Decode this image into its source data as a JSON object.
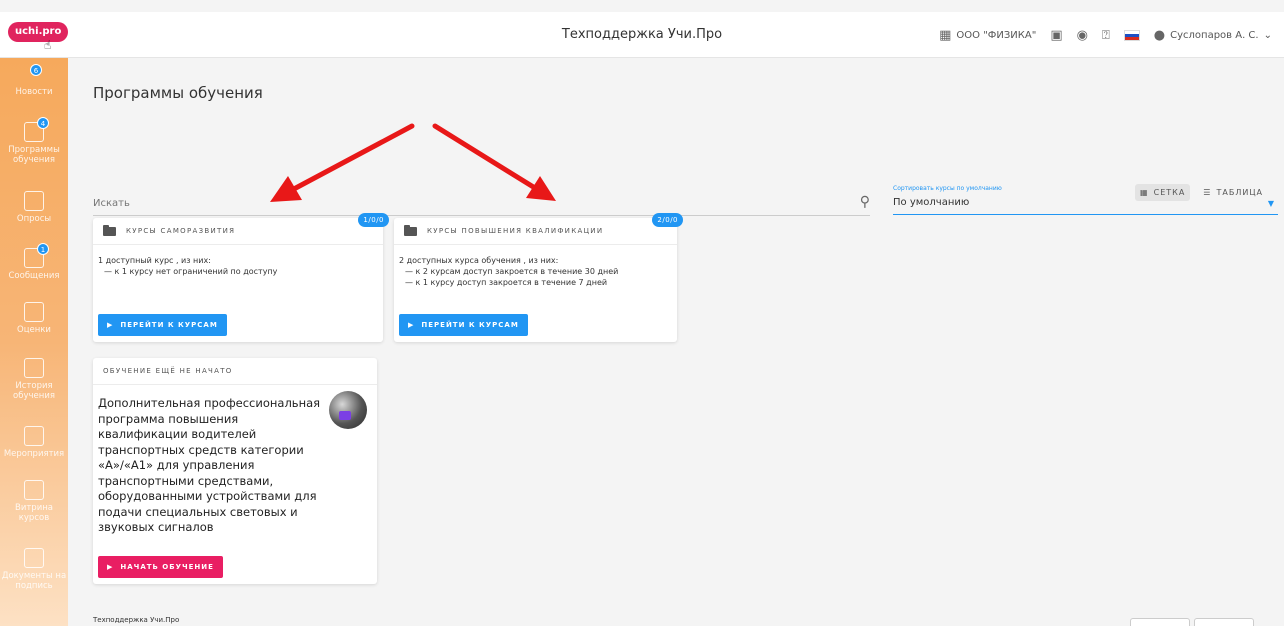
{
  "header": {
    "logo_text": "uchi.pro",
    "title": "Техподдержка Учи.Про",
    "org": "ООО \"ФИЗИКА\"",
    "user": "Суслопаров А. С."
  },
  "sidebar": {
    "items": [
      {
        "label": "Новости",
        "badge": "6"
      },
      {
        "label": "Программы обучения",
        "badge": "4"
      },
      {
        "label": "Опросы",
        "badge": ""
      },
      {
        "label": "Сообщения",
        "badge": "1"
      },
      {
        "label": "Оценки",
        "badge": ""
      },
      {
        "label": "История обучения",
        "badge": ""
      },
      {
        "label": "Мероприятия",
        "badge": ""
      },
      {
        "label": "Витрина курсов",
        "badge": ""
      },
      {
        "label": "Документы на подпись",
        "badge": ""
      }
    ]
  },
  "main": {
    "title": "Программы обучения",
    "search_placeholder": "Искать",
    "sort_label": "Сортировать курсы по умолчанию",
    "sort_value": "По умолчанию",
    "view_grid": "СЕТКА",
    "view_table": "ТАБЛИЦА"
  },
  "cards": [
    {
      "title": "КУРСЫ САМОРАЗВИТИЯ",
      "counter": "1/0/0",
      "summary": "1 доступный курс , из них:",
      "lines": [
        "— к 1 курсу нет ограничений по доступу"
      ],
      "button": "ПЕРЕЙТИ К КУРСАМ"
    },
    {
      "title": "КУРСЫ ПОВЫШЕНИЯ КВАЛИФИКАЦИИ",
      "counter": "2/0/0",
      "summary": "2 доступных курса обучения , из них:",
      "lines": [
        "— к 2 курсам доступ закроется в течение 30 дней",
        "— к 1 курсу доступ закроется в течение 7 дней"
      ],
      "button": "ПЕРЕЙТИ К КУРСАМ"
    }
  ],
  "program_card": {
    "status": "ОБУЧЕНИЕ ЕЩЁ НЕ НАЧАТО",
    "title": "Дополнительная профессиональная программа повышения квалификации водителей транспортных средств категории «А»/«А1» для управления транспортными средствами, оборудованными устройствами для подачи специальных световых и звуковых сигналов",
    "button": "НАЧАТЬ ОБУЧЕНИЕ"
  },
  "footer": {
    "text": "Техподдержка Учи.Про"
  },
  "colors": {
    "accent": "#2196f3",
    "pink": "#e91e63",
    "sidebar": "#f6a95c",
    "arrow": "#e81818"
  }
}
